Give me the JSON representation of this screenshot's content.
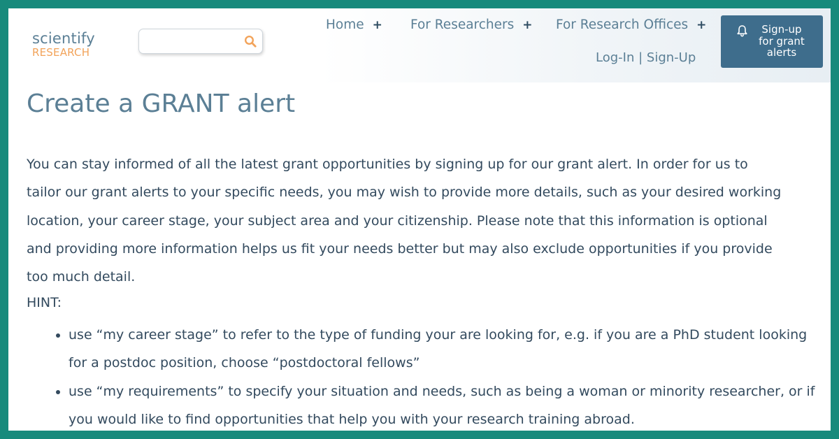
{
  "brand": {
    "name": "scientify",
    "sub": "RESEARCH"
  },
  "search": {
    "placeholder": "",
    "value": ""
  },
  "nav": {
    "items": [
      {
        "label": "Home",
        "expander": "+"
      },
      {
        "label": "For Researchers",
        "expander": "+"
      },
      {
        "label": "For Research Offices",
        "expander": "+"
      }
    ],
    "login": "Log-In",
    "separator": "|",
    "signup": "Sign-Up",
    "alert_button": "Sign-up for grant alerts"
  },
  "page": {
    "title": "Create a GRANT alert",
    "intro": "You can stay informed of all the latest grant opportunities by signing up for our grant alert. In order for us to tailor our grant alerts to your specific needs, you may wish to provide more details, such as your desired working location, your career stage, your subject area and your citizenship. Please note that this information is optional and providing more information helps us fit your needs better but may also exclude opportunities if you provide too much detail.",
    "hint_label": "HINT:",
    "hints": [
      "use “my career stage” to refer to the type of funding your are looking for, e.g. if you are a PhD student looking for a postdoc position, choose “postdoctoral fellows”",
      "use “my requirements” to specify your situation and needs, such as being a woman or minority researcher, or if you would like to find opportunities that help you with your research training abroad."
    ]
  },
  "colors": {
    "frame": "#178a7c",
    "accent": "#f2a35a",
    "heading": "#5b7f95",
    "button": "#3e6d8c",
    "text": "#334a5e"
  },
  "icons": {
    "search": "search-icon",
    "bell": "bell-icon",
    "expand": "plus-icon"
  }
}
